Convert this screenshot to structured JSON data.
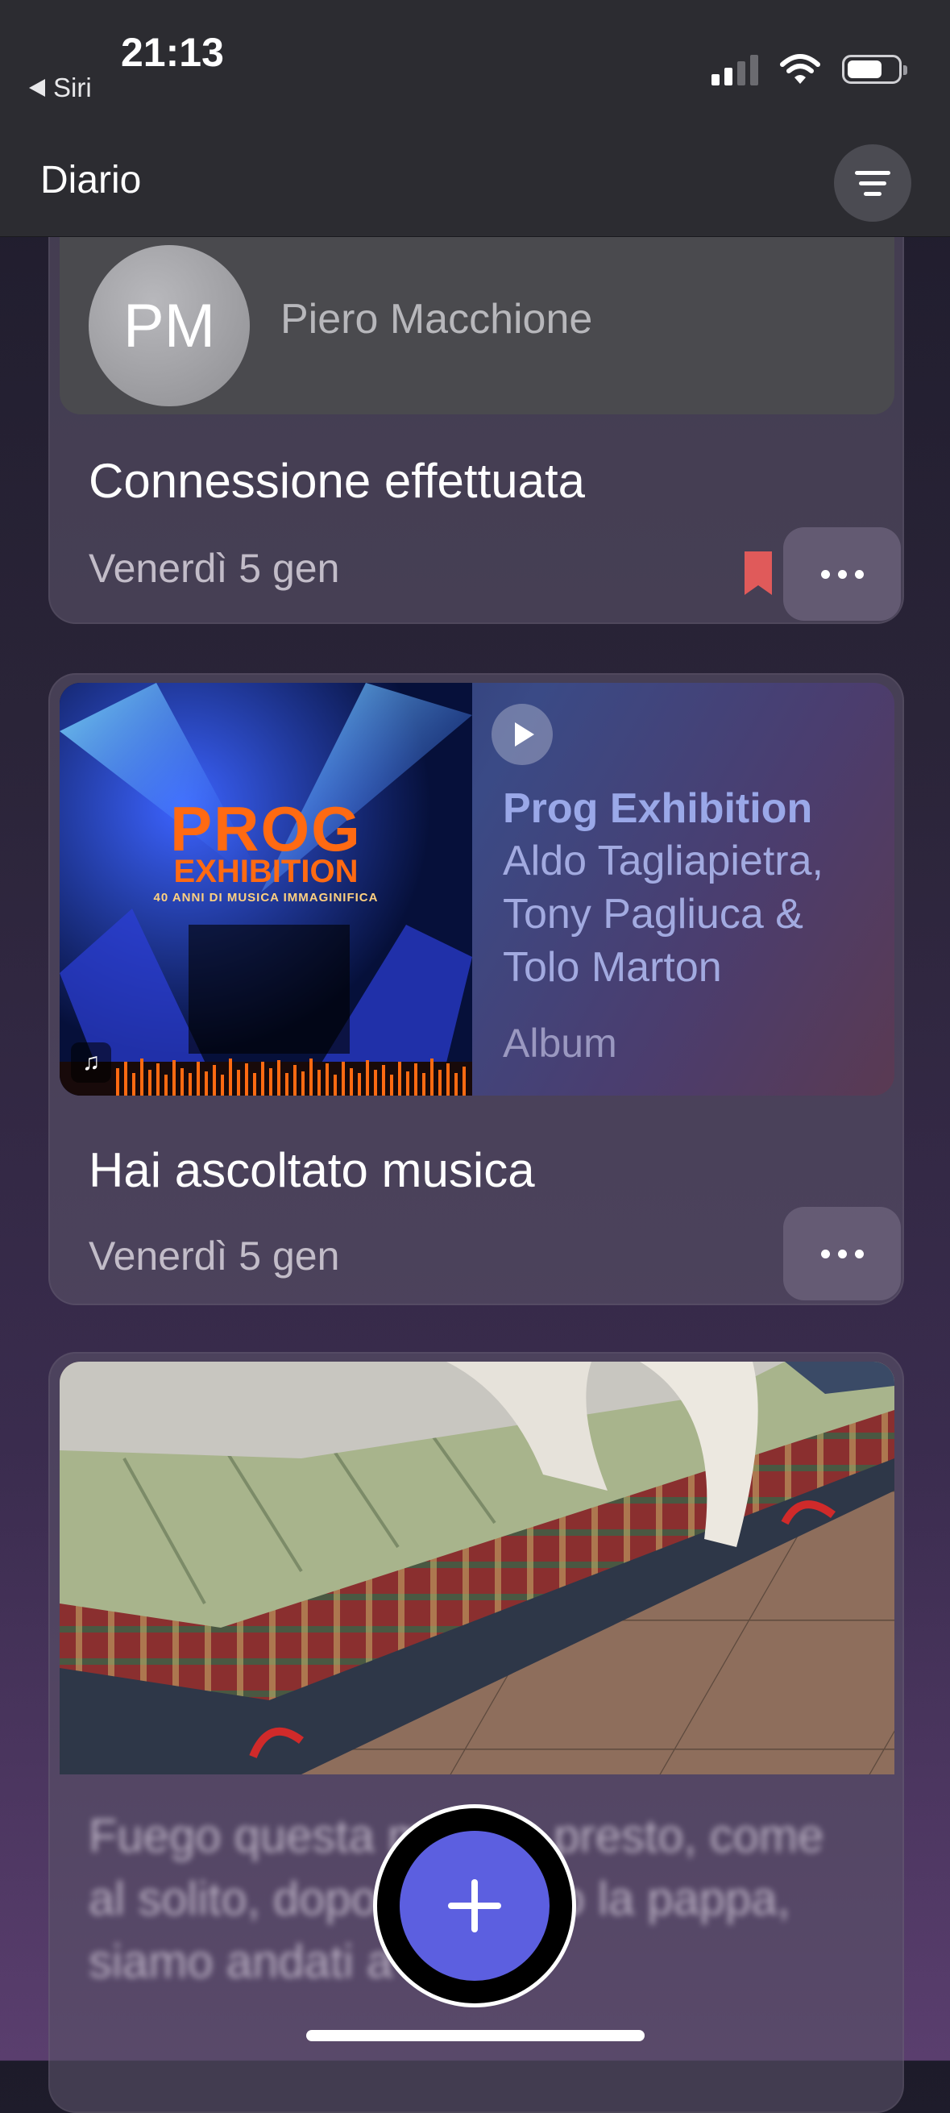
{
  "status_bar": {
    "time": "21:13",
    "back_label": "Siri",
    "icons": [
      "cellular-signal-icon",
      "wifi-icon",
      "battery-icon"
    ]
  },
  "header": {
    "title": "Diario",
    "filter_icon": "filter-lines-icon"
  },
  "entries": [
    {
      "contact_initials": "PM",
      "contact_name": "Piero Macchione",
      "title": "Connessione effettuata",
      "date": "Venerdì 5 gen",
      "bookmarked": true,
      "bookmark_color": "#e05a5a"
    },
    {
      "album_art_text": [
        "PROG",
        "EXHIBITION",
        "40 ANNI DI MUSICA IMMAGINIFICA"
      ],
      "album_title": "Prog Exhibition",
      "album_artist": "Aldo Tagliapietra, Tony Pagliuca & Tolo Marton",
      "album_kind": "Album",
      "title": "Hai ascoltato musica",
      "date": "Venerdì 5 gen"
    },
    {
      "photo_description_icon": "photo-dog-on-bed",
      "note_text": "Fuego questa mattina presto, come al solito, dopo aver fatto la pappa, siamo andati a fare la"
    }
  ],
  "fab": {
    "icon": "plus-icon",
    "color": "#5c5fe0"
  }
}
